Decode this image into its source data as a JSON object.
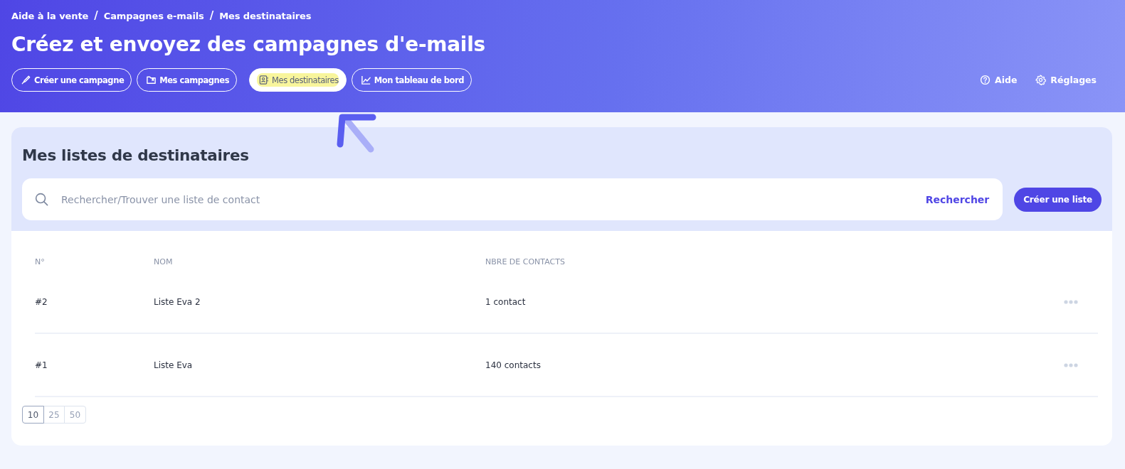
{
  "breadcrumb": {
    "items": [
      "Aide à la vente",
      "Campagnes e-mails",
      "Mes destinataires"
    ],
    "separators": [
      "/",
      "/"
    ]
  },
  "title": "Créez et envoyez des campagnes d'e-mails",
  "tabs": [
    {
      "label": "Créer une campagne",
      "selected": false,
      "highlighted": false
    },
    {
      "label": "Mes campagnes",
      "selected": false,
      "highlighted": false
    },
    {
      "label": "Mes destinataires",
      "selected": true,
      "highlighted": true
    },
    {
      "label": "Mon tableau de bord",
      "selected": false,
      "highlighted": false
    }
  ],
  "header_links": [
    {
      "label": "Aide"
    },
    {
      "label": "Réglages"
    }
  ],
  "panel": {
    "heading": "Mes listes de destinataires",
    "search": {
      "placeholder": "Rechercher/Trouver une liste de contact",
      "button": "Rechercher"
    },
    "create_button": "Créer une liste"
  },
  "table": {
    "columns": [
      "N°",
      "NOM",
      "NBRE DE CONTACTS"
    ],
    "rows": [
      {
        "number": "#2",
        "name": "Liste Eva 2",
        "contacts": "1 contact"
      },
      {
        "number": "#1",
        "name": "Liste Eva",
        "contacts": "140 contacts"
      }
    ]
  },
  "page_sizes": [
    {
      "label": "10",
      "selected": true
    },
    {
      "label": "25",
      "selected": false
    },
    {
      "label": "50",
      "selected": false
    }
  ]
}
